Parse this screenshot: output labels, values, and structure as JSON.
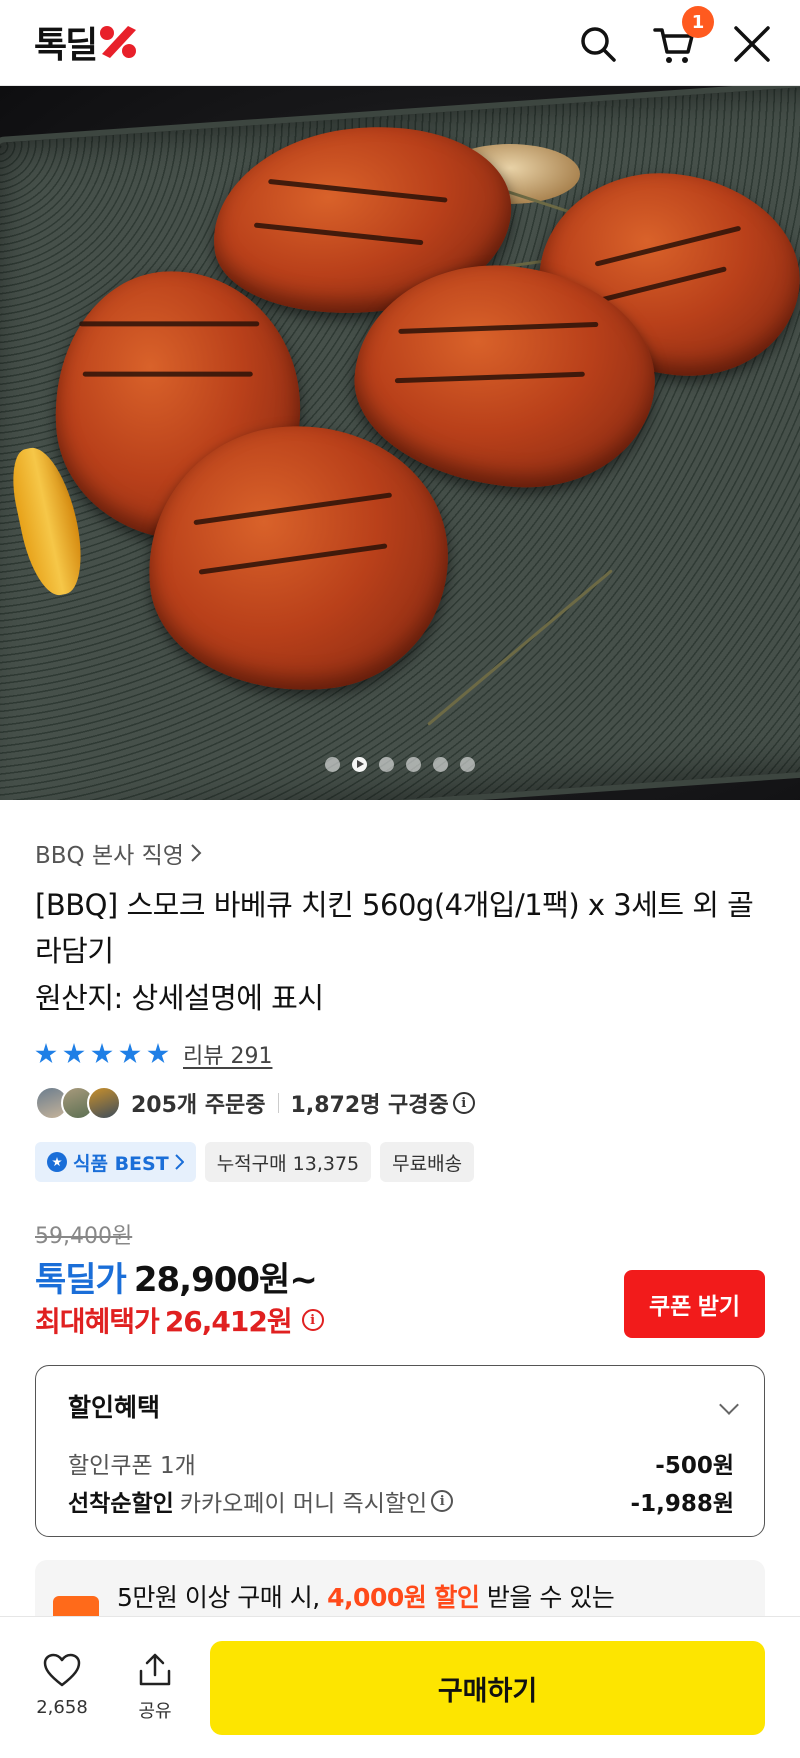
{
  "header": {
    "logo_text": "톡딜",
    "cart_count": "1",
    "icons": [
      "search-icon",
      "cart-icon",
      "close-icon"
    ]
  },
  "gallery": {
    "image_alt": "",
    "dots": 6,
    "active_index": 1
  },
  "product": {
    "seller": "BBQ 본사 직영",
    "title": "[BBQ] 스모크 바베큐 치킨 560g(4개입/1팩) x 3세트 외 골라담기",
    "origin": "원산지: 상세설명에 표시",
    "rating_stars": 5,
    "review_label": "리뷰 291",
    "orders_text": "205개 주문중",
    "viewers_text": "1,872명 구경중",
    "tags": {
      "best": "식품 BEST",
      "cumulative": "누적구매 13,375",
      "shipping": "무료배송"
    }
  },
  "price": {
    "original": "59,400원",
    "deal_label": "톡딜가",
    "deal_price": "28,900원~",
    "max_label": "최대혜택가",
    "max_price": "26,412원",
    "coupon_button": "쿠폰 받기"
  },
  "discount": {
    "title": "할인혜택",
    "rows": [
      {
        "label": "할인쿠폰 1개",
        "value": "-500원"
      },
      {
        "label_bold": "선착순할인",
        "label": "카카오페이 머니 즉시할인",
        "value": "-1,988원"
      }
    ]
  },
  "promo": {
    "prefix": "5만원 이상 구매 시,",
    "highlight": "4,000원 할인",
    "suffix": "받을 수 있는"
  },
  "bottom_bar": {
    "like_count": "2,658",
    "share_label": "공유",
    "buy_label": "구매하기"
  },
  "colors": {
    "accent_blue": "#1a6ed8",
    "price_red": "#e02020",
    "coupon_red": "#f21b1b",
    "buy_yellow": "#fde500",
    "badge_orange": "#ff5a1f"
  }
}
